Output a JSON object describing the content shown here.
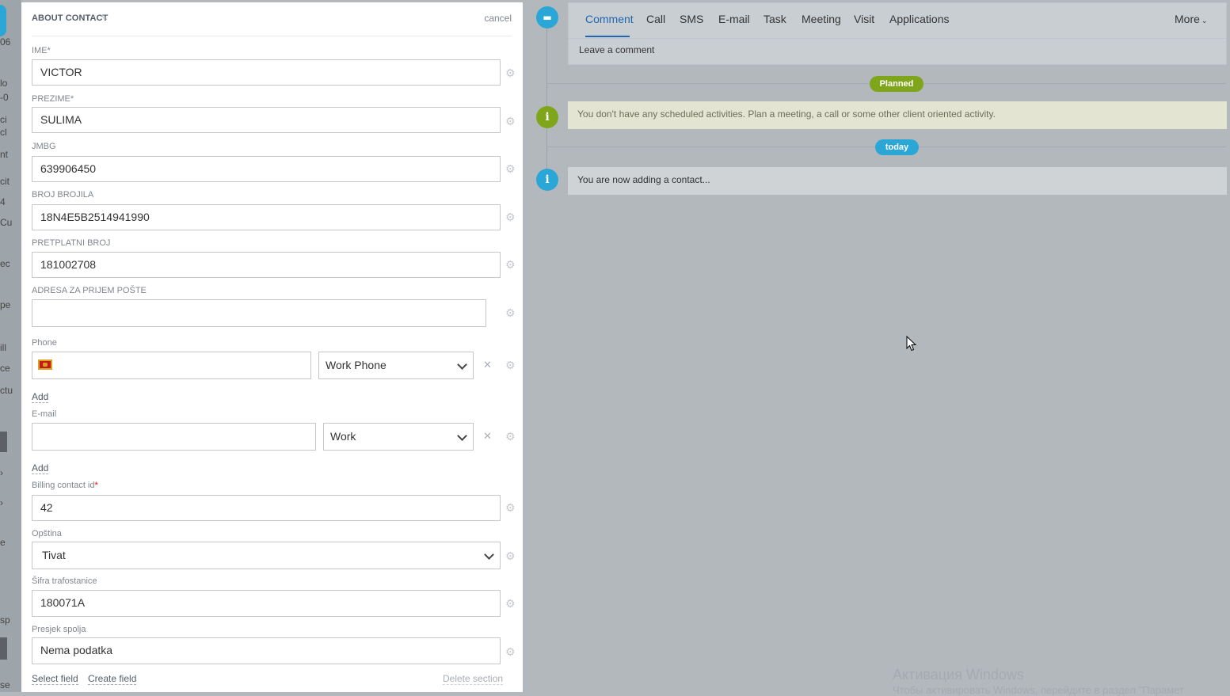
{
  "panel": {
    "title": "ABOUT CONTACT",
    "cancel": "cancel"
  },
  "fields": {
    "ime": {
      "label": "IME*",
      "value": "VICTOR"
    },
    "prezime": {
      "label": "PREZIME*",
      "value": "SULIMA"
    },
    "jmbg": {
      "label": "JMBG",
      "value": "639906450"
    },
    "broj_brojila": {
      "label": "BROJ BROJILA",
      "value": "18N4E5B2514941990"
    },
    "pretplatni_broj": {
      "label": "PRETPLATNI BROJ",
      "value": "181002708"
    },
    "adresa": {
      "label": "ADRESA ZA PRIJEM POŠTE",
      "value": ""
    },
    "phone": {
      "label": "Phone",
      "value": "",
      "type": "Work Phone",
      "add": "Add"
    },
    "email": {
      "label": "E-mail",
      "value": "",
      "type": "Work",
      "add": "Add"
    },
    "billing": {
      "label": "Billing contact id",
      "required_mark": "*",
      "value": "42"
    },
    "opstina": {
      "label": "Opština",
      "value": "Tivat"
    },
    "sifra": {
      "label": "Šifra trafostanice",
      "value": "180071A"
    },
    "presjek": {
      "label": "Presjek spolja",
      "value": "Nema podatka"
    }
  },
  "footer": {
    "select_field": "Select field",
    "create_field": "Create field",
    "delete_section": "Delete section"
  },
  "timeline": {
    "tabs": [
      "Comment",
      "Call",
      "SMS",
      "E-mail",
      "Task",
      "Meeting",
      "Visit",
      "Applications"
    ],
    "more": "More",
    "comment_placeholder": "Leave a comment",
    "planned_badge": "Planned",
    "planned_notice": "You don't have any scheduled activities. Plan a meeting, a call or some other client oriented activity.",
    "today_badge": "today",
    "adding_notice": "You are now adding a contact..."
  },
  "watermark": {
    "line1": "Активация Windows",
    "line2": "Чтобы активировать Windows, перейдите в раздел \"Парамет"
  },
  "colors": {
    "accent_blue": "#2066b0",
    "timeline_blue": "#2aa7d6",
    "planned_green": "#7fa61b",
    "notice_yellow": "#e3e4d2",
    "notice_gray": "#cfd3d6"
  },
  "background_fragments": [
    "06",
    "lo",
    "-0",
    "ci",
    "cl",
    "nt",
    "cit",
    "4",
    "Cu",
    "ec",
    "pe",
    "ill",
    "ce",
    "ctu",
    "e",
    "sp",
    "se"
  ]
}
